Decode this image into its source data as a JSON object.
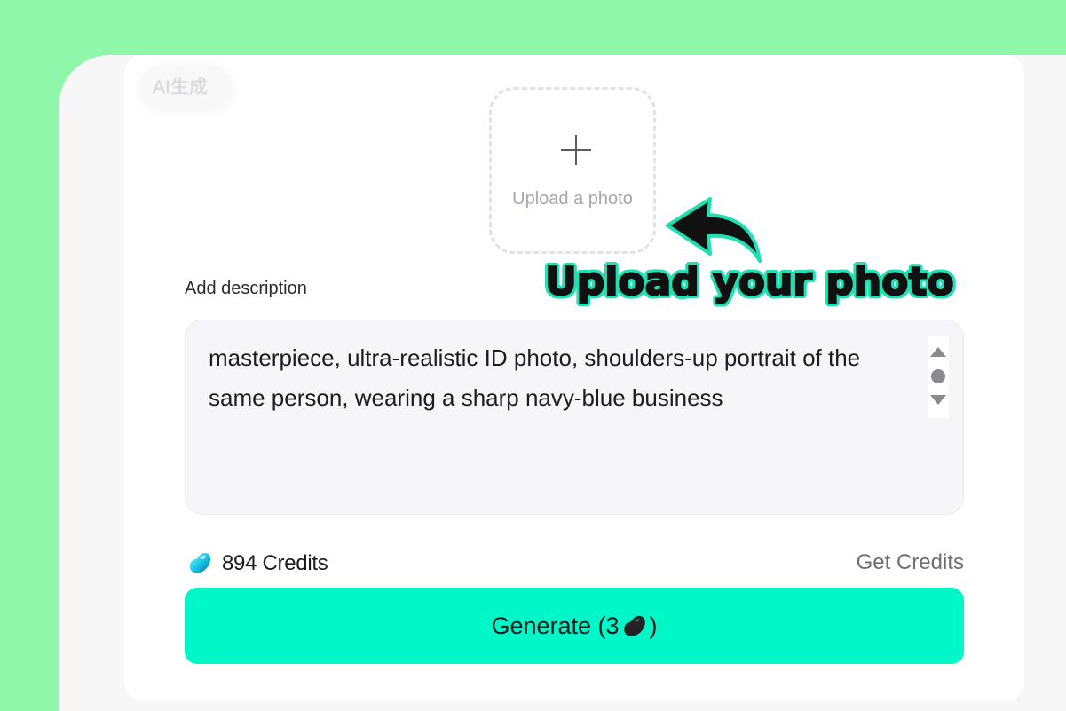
{
  "badge": {
    "label": "AI生成"
  },
  "upload": {
    "label": "Upload a photo"
  },
  "callout": {
    "text": "Upload your photo"
  },
  "description": {
    "label": "Add description",
    "value": "masterpiece, ultra-realistic ID photo, shoulders-up portrait of the same person, wearing a sharp navy-blue business"
  },
  "credits": {
    "balance_label": "894 Credits",
    "get_label": "Get Credits",
    "icon": "bean-icon"
  },
  "generate": {
    "prefix": "Generate (3",
    "suffix": ")",
    "icon": "bean-icon"
  },
  "colors": {
    "background": "#8ef7a9",
    "accent": "#00f7c8",
    "callout_outline": "#1fe0b0"
  }
}
